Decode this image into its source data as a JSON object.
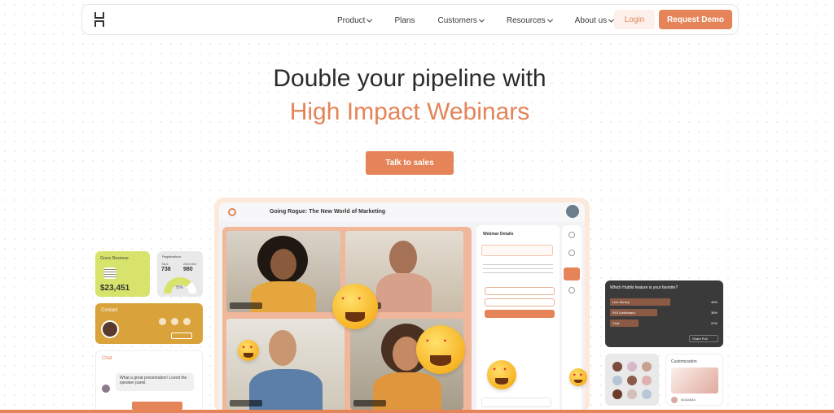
{
  "nav": {
    "items": [
      {
        "label": "Product",
        "dropdown": true
      },
      {
        "label": "Plans",
        "dropdown": false
      },
      {
        "label": "Customers",
        "dropdown": true
      },
      {
        "label": "Resources",
        "dropdown": true
      },
      {
        "label": "About us",
        "dropdown": true
      }
    ],
    "login_label": "Login",
    "demo_label": "Request Demo"
  },
  "hero": {
    "line1": "Double your pipeline with",
    "line2": "High Impact Webinars",
    "cta_label": "Talk to sales"
  },
  "app": {
    "title": "Going Rogue: The New World of Marketing",
    "panel_title": "Webinar Details"
  },
  "cards": {
    "revenue": {
      "label": "Gross Revenue",
      "value": "$23,451"
    },
    "registrations": {
      "label": "Registrations",
      "total_label": "Total",
      "total": "738",
      "attended_label": "Attended",
      "attended": "980",
      "gauge_value": "75%",
      "gauge_fraction": 0.75
    },
    "contact": {
      "label": "Contact"
    },
    "chat": {
      "label": "Chat",
      "message": "What a great presentation! Loved the speaker panel."
    },
    "poll": {
      "question": "Which Hubilo feature is your favorite?",
      "options": [
        {
          "label": "Live Survey",
          "pct": "46%",
          "value": 46
        },
        {
          "label": "ROI Dashboard",
          "pct": "36%",
          "value": 36
        },
        {
          "label": "Chat",
          "pct": "22%",
          "value": 22
        }
      ],
      "button": "Share Poll"
    },
    "customization": {
      "label": "Customization",
      "code": "#DAABA0"
    }
  },
  "colors": {
    "accent": "#e48458",
    "lime": "#d7e36a",
    "gold": "#d9a23a",
    "dark": "#3a3a3a"
  }
}
